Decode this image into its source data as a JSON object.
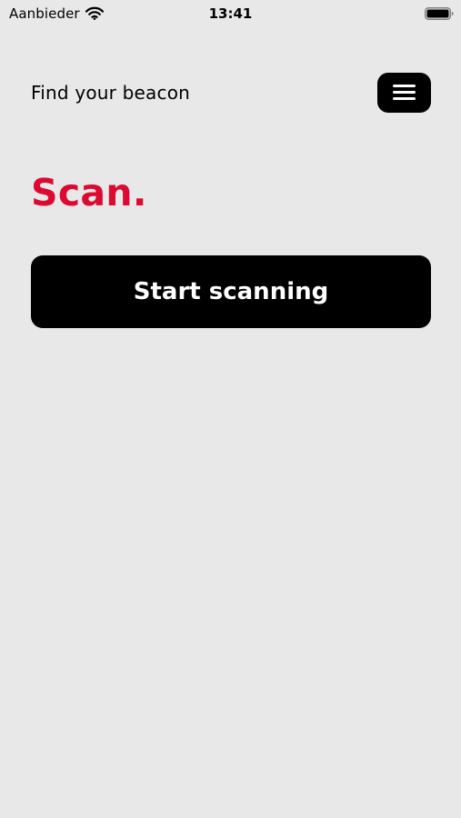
{
  "status_bar": {
    "carrier": "Aanbieder",
    "time": "13:41",
    "icons": [
      "wifi-icon",
      "battery-icon"
    ]
  },
  "header": {
    "subtitle": "Find your beacon",
    "menu_icon": "menu-icon"
  },
  "main": {
    "title": "Scan.",
    "start_button_label": "Start scanning"
  },
  "colors": {
    "background": "#e8e8e8",
    "accent": "#dc0a32",
    "button": "#000000",
    "button_text": "#ffffff"
  }
}
